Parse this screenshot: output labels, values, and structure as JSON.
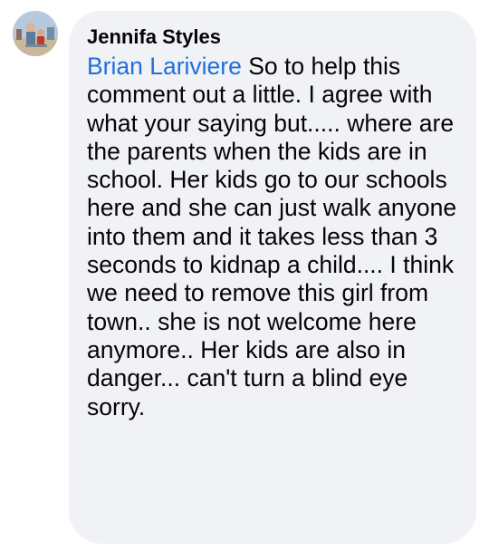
{
  "comment": {
    "author_name": "Jennifa Styles",
    "mention_name": "Brian Lariviere",
    "text": "So to help this comment out a little. I agree with what your saying but..... where are the parents when the kids are in school. Her kids go to our schools here and she can just walk anyone into them and it takes less than 3 seconds to kidnap a child.... I think we need to remove this girl from town.. she is not welcome here anymore.. Her kids are also in danger... can't turn a blind eye sorry."
  },
  "colors": {
    "bubble_bg": "#f0f2f5",
    "mention": "#216fdb",
    "text": "#050505"
  }
}
